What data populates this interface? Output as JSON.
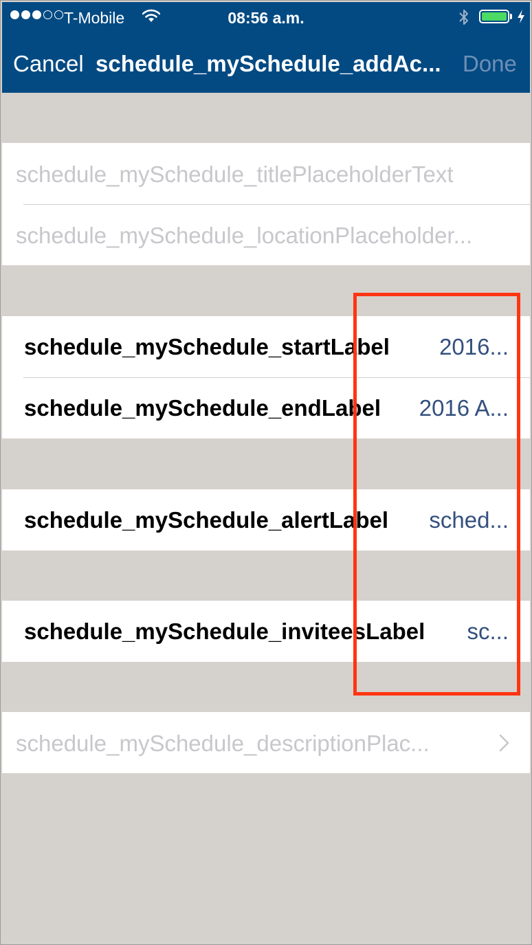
{
  "status_bar": {
    "carrier": "T-Mobile",
    "time": "08:56 a.m.",
    "signal_bars_filled": 3,
    "signal_bars_total": 5,
    "battery_fill": 1.0
  },
  "nav": {
    "cancel": "Cancel",
    "title": "schedule_mySchedule_addAc...",
    "done": "Done"
  },
  "fields": {
    "title_placeholder": "schedule_mySchedule_titlePlaceholderText",
    "location_placeholder": "schedule_mySchedule_locationPlaceholder...",
    "description_placeholder": "schedule_mySchedule_descriptionPlac..."
  },
  "rows": {
    "start": {
      "label": "schedule_mySchedule_startLabel",
      "value": "2016..."
    },
    "end": {
      "label": "schedule_mySchedule_endLabel",
      "value": "2016 A..."
    },
    "alert": {
      "label": "schedule_mySchedule_alertLabel",
      "value": "sched..."
    },
    "invitees": {
      "label": "schedule_mySchedule_inviteesLabel",
      "value": "sc..."
    }
  },
  "colors": {
    "nav_background": "#034a83",
    "page_background": "#d5d1cc",
    "value_text": "#34507e",
    "placeholder_text": "#c7c7cc",
    "highlight": "#ff3512",
    "battery": "#4cd964"
  },
  "icons": [
    "wifi-icon",
    "bluetooth-icon",
    "battery-icon",
    "charging-icon",
    "chevron-right-icon"
  ]
}
